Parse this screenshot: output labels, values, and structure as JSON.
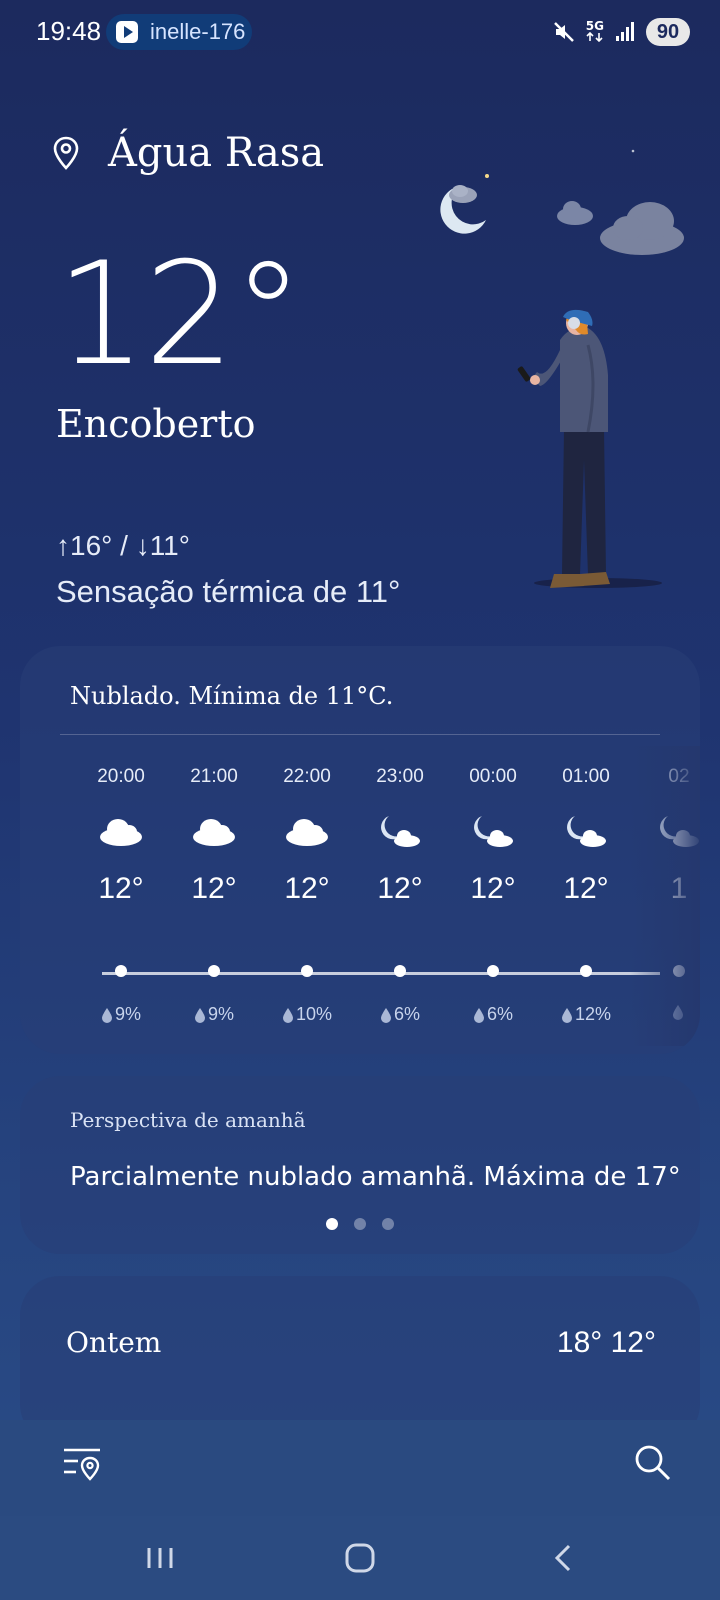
{
  "status_bar": {
    "time": "19:48",
    "media_chip_text": "inelle-176",
    "network": "5G",
    "battery": "90"
  },
  "header": {
    "location": "Água Rasa",
    "temperature": "12°",
    "condition": "Encoberto",
    "high": "↑16°",
    "slash": "/",
    "low": "↓11°",
    "feels_like": "Sensação térmica de 11°"
  },
  "hourly": {
    "summary": "Nublado. Mínima de 11°C.",
    "items": [
      {
        "time": "20:00",
        "icon": "cloud-icon",
        "temp": "12°",
        "rain": "9%"
      },
      {
        "time": "21:00",
        "icon": "cloud-icon",
        "temp": "12°",
        "rain": "9%"
      },
      {
        "time": "22:00",
        "icon": "cloud-icon",
        "temp": "12°",
        "rain": "10%"
      },
      {
        "time": "23:00",
        "icon": "moon-cloud-icon",
        "temp": "12°",
        "rain": "6%"
      },
      {
        "time": "00:00",
        "icon": "moon-cloud-icon",
        "temp": "12°",
        "rain": "6%"
      },
      {
        "time": "01:00",
        "icon": "moon-cloud-icon",
        "temp": "12°",
        "rain": "12%"
      },
      {
        "time": "02",
        "icon": "moon-cloud-icon",
        "temp": "1",
        "rain": ""
      }
    ]
  },
  "tomorrow": {
    "title": "Perspectiva de amanhã",
    "text": "Parcialmente nublado amanhã. Máxima de 17°"
  },
  "daily": {
    "label": "Ontem",
    "temps": "18° 12°"
  },
  "colors": {
    "background_top": "#1c2a5e",
    "background_bottom": "#2a4d88",
    "card": "#283e76",
    "chip": "#113c78"
  }
}
